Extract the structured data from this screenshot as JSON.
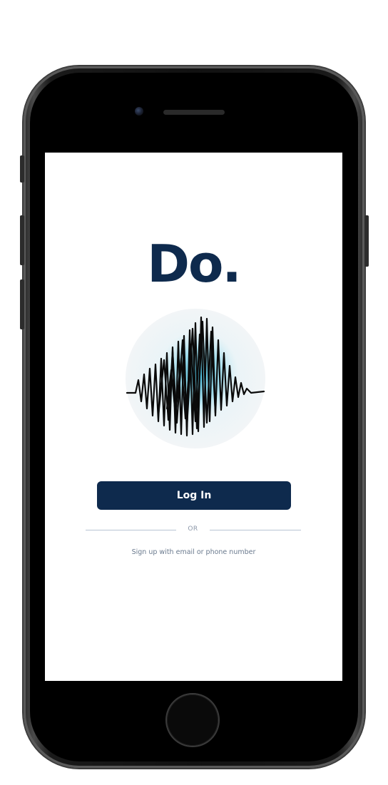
{
  "app": {
    "logo_text": "Do.",
    "login_button": "Log In",
    "divider_text": "OR",
    "signup_link": "Sign up with email or phone number"
  },
  "icons": {
    "logo_graphic": "waveform-icon",
    "home": "home-button"
  },
  "colors": {
    "brand_navy": "#0e2a4d",
    "accent_cyan": "#4fc3dc",
    "divider": "#b8c4d4",
    "muted_text": "#6a7a8e"
  }
}
